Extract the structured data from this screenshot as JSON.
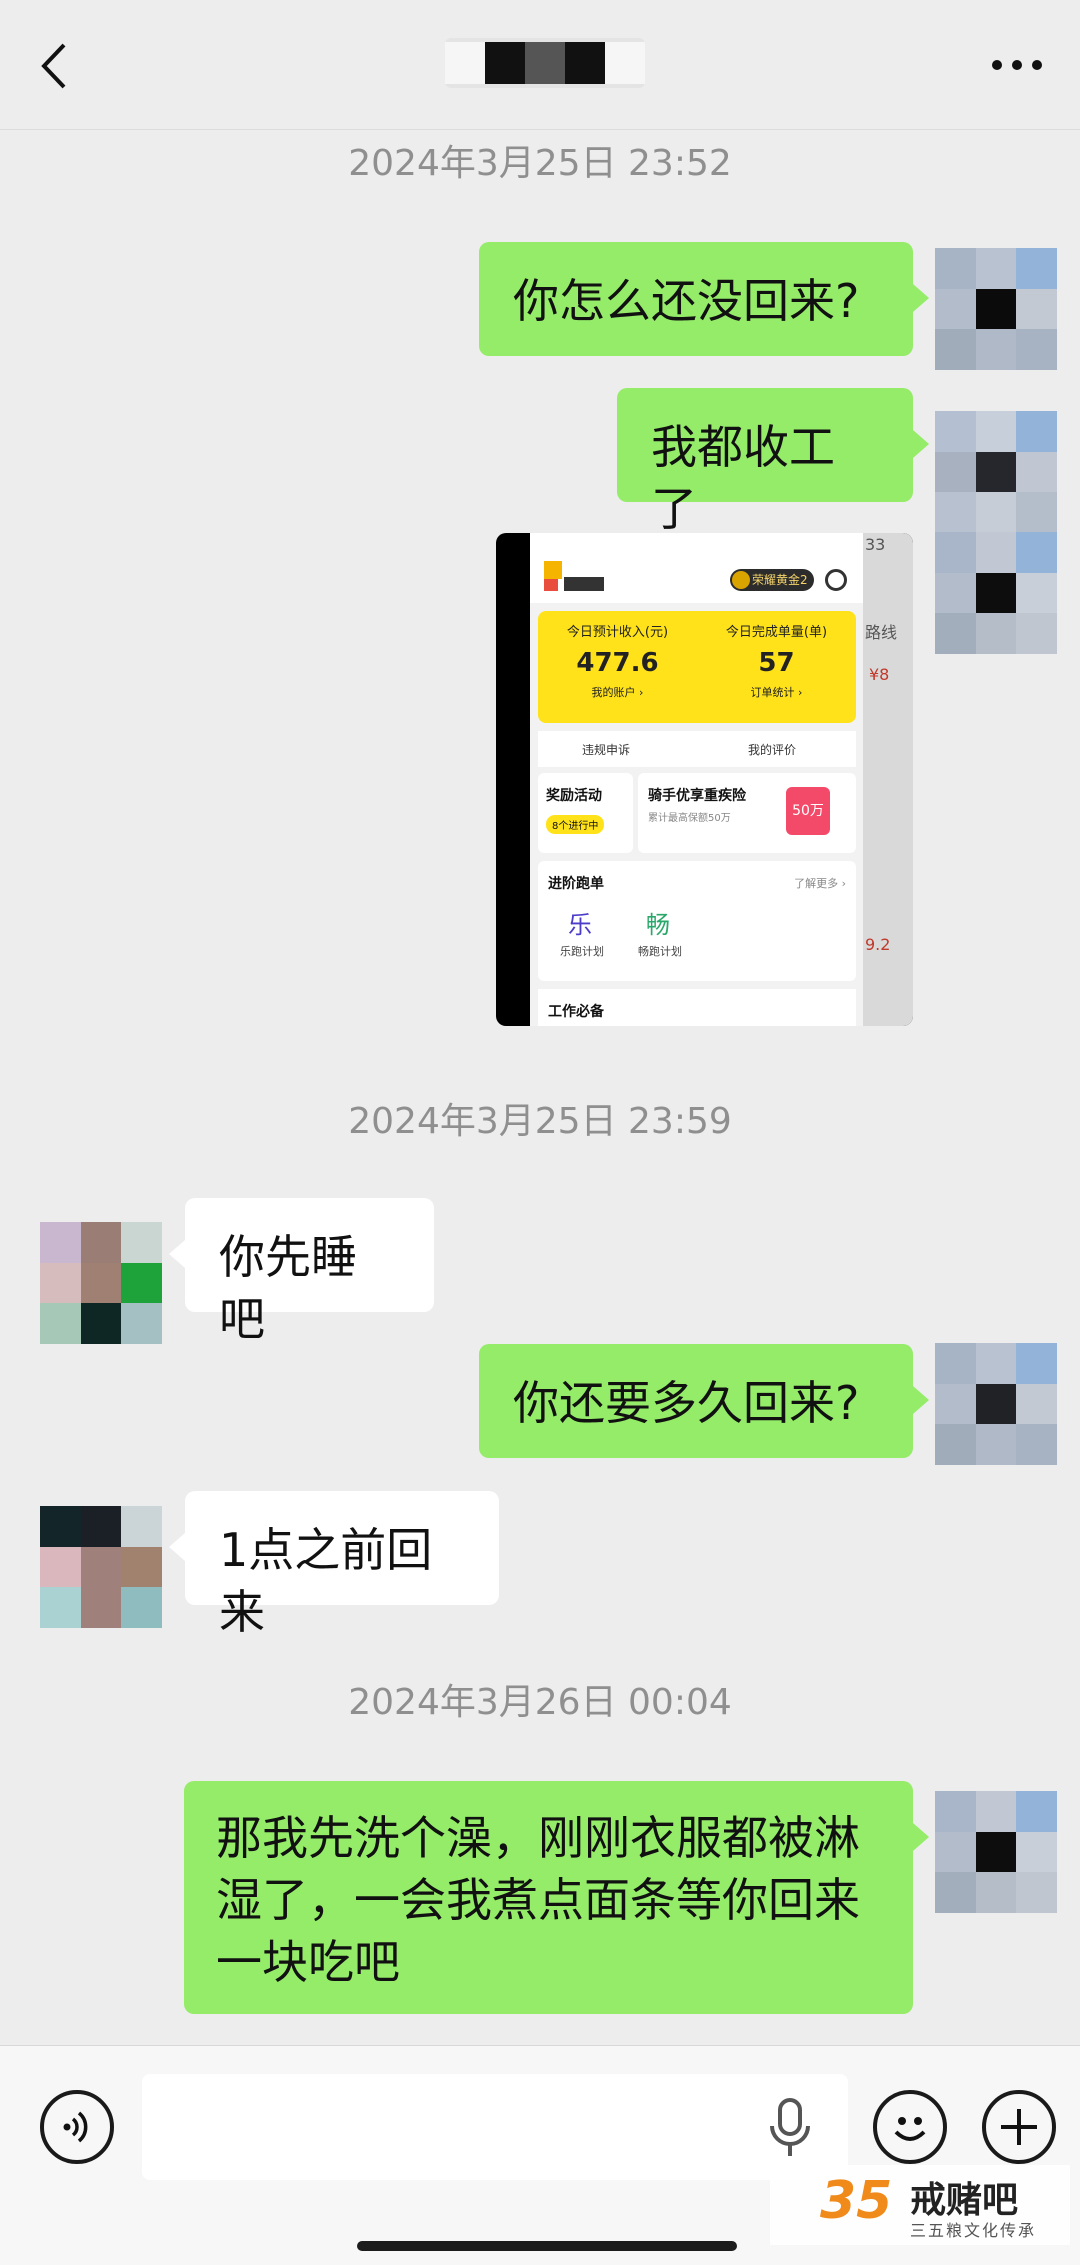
{
  "header": {
    "title_mosaic": [
      "#ffffff",
      "#111111",
      "#555555",
      "#111111",
      "#f2f2f2"
    ]
  },
  "messages": {
    "time1": "2024年3月25日 23:52",
    "me1": "你怎么还没回来?",
    "me2": "我都收工了",
    "time2": "2024年3月25日 23:59",
    "them1": "你先睡吧",
    "me3": "你还要多久回来?",
    "them2": "1点之前回来",
    "time3": "2024年3月26日 00:04",
    "me4": "那我先洗个澡，刚刚衣服都被淋湿了，一会我煮点面条等你回来一块吃吧"
  },
  "image_message": {
    "badge": "荣耀黄金2",
    "income_label": "今日预计收入(元)",
    "income_value": "477.6",
    "income_link": "我的账户 ›",
    "orders_label": "今日完成单量(单)",
    "orders_value": "57",
    "orders_link": "订单统计 ›",
    "appeal": "违规申诉",
    "review": "我的评价",
    "reward_title": "奖励活动",
    "reward_pill": "8个进行中",
    "insurance_title": "骑手优享重疾险",
    "insurance_sub": "累计最高保额50万",
    "insurance_badge": "50万",
    "plan_title": "进阶跑单",
    "plan_more": "了解更多 ›",
    "plan1_icon": "乐",
    "plan1_label": "乐跑计划",
    "plan2_icon": "畅",
    "plan2_label": "畅跑计划",
    "work_title": "工作必备",
    "side_text1": "33",
    "side_text2": "路线",
    "side_text3": "¥8",
    "side_text4": "9.2"
  },
  "watermark": {
    "number": "35",
    "name": "戒赌吧",
    "sub": "三五粮文化传承"
  },
  "colors": {
    "my_bubble": "#95ec69",
    "their_bubble": "#ffffff",
    "background": "#ededed"
  },
  "icons": [
    "back-icon",
    "more-icon",
    "voice-icon",
    "mic-icon",
    "emoji-icon",
    "plus-icon"
  ]
}
